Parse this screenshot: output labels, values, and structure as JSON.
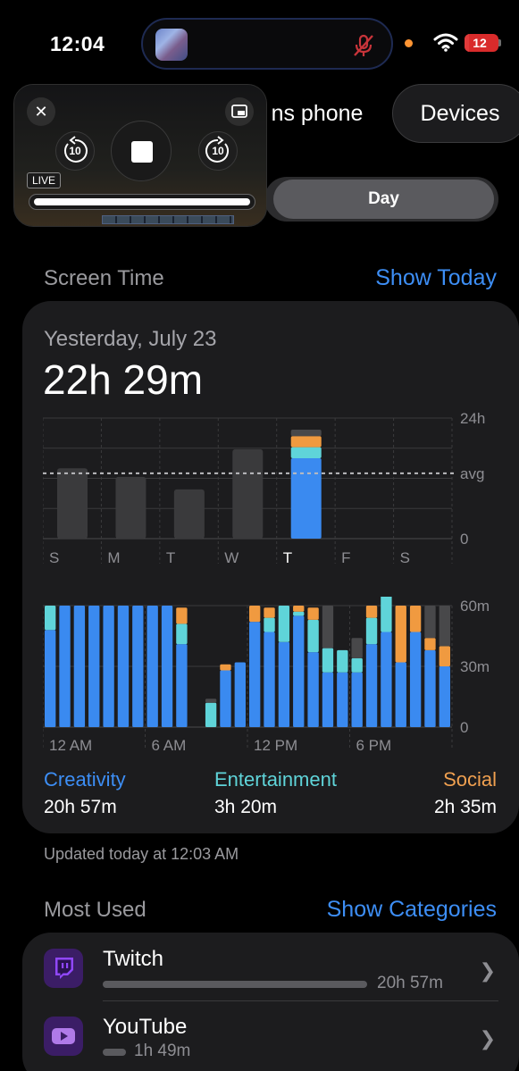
{
  "status_bar": {
    "time": "12:04",
    "battery": "12",
    "battery_level": 0.12,
    "icons": [
      "now-playing-art",
      "mic-muted-icon",
      "privacy-dot",
      "wifi-icon",
      "battery-charging-icon"
    ]
  },
  "device_tabs": {
    "phone_label": "ns phone",
    "devices_label": "Devices"
  },
  "segment": {
    "day_label": "Day"
  },
  "pip": {
    "live_label": "LIVE",
    "skip_back_label": "10",
    "skip_forward_label": "10",
    "progress": 1.0,
    "icons": [
      "close-icon",
      "pip-expand-icon",
      "skip-back-10-icon",
      "stop-icon",
      "skip-forward-10-icon"
    ]
  },
  "screen_time": {
    "section_title": "Screen Time",
    "show_today": "Show Today",
    "date_label": "Yesterday, July 23",
    "total": "22h 29m"
  },
  "chart_data": [
    {
      "type": "bar",
      "categories": [
        "S",
        "M",
        "T",
        "W",
        "T",
        "F",
        "S"
      ],
      "ytick_labels": [
        "24h",
        "avg",
        "0"
      ],
      "ylim": [
        0,
        24
      ],
      "avg_hours": 13,
      "values_hours": [
        14.0,
        12.3,
        9.8,
        17.8,
        22.5,
        0,
        0
      ],
      "stacked_selected_day": {
        "index": 4,
        "creativity": 16.0,
        "entertainment": 2.2,
        "social": 2.2,
        "other": 1.3
      },
      "colors": {
        "inactive": "#3a3a3c",
        "creativity": "#3a8af0",
        "entertainment": "#5fd4d9",
        "social": "#f09a40",
        "other": "#48484a"
      }
    },
    {
      "type": "bar",
      "x_tick_labels": [
        "12 AM",
        "6 AM",
        "12 PM",
        "6 PM"
      ],
      "ytick_labels": [
        "60m",
        "30m",
        "0"
      ],
      "ylim": [
        0,
        60
      ],
      "series": [
        {
          "name": "Creativity",
          "values": [
            48,
            60,
            60,
            60,
            60,
            60,
            60,
            60,
            60,
            41,
            0,
            0,
            28,
            32,
            52,
            47,
            42,
            55,
            37,
            27,
            27,
            27,
            41,
            47,
            32,
            47,
            38,
            30
          ]
        },
        {
          "name": "Entertainment",
          "values": [
            12,
            0,
            0,
            0,
            0,
            0,
            0,
            0,
            0,
            10,
            0,
            12,
            0,
            0,
            0,
            7,
            18,
            2,
            16,
            12,
            11,
            7,
            13,
            18,
            0,
            0,
            0,
            0
          ]
        },
        {
          "name": "Social",
          "values": [
            0,
            0,
            0,
            0,
            0,
            0,
            0,
            0,
            0,
            8,
            0,
            0,
            3,
            0,
            8,
            5,
            0,
            3,
            6,
            0,
            0,
            0,
            6,
            0,
            28,
            13,
            6,
            10
          ]
        }
      ],
      "other_values": [
        0,
        0,
        0,
        0,
        0,
        0,
        0,
        0,
        0,
        0,
        0,
        2,
        0,
        0,
        0,
        0,
        0,
        0,
        0,
        21,
        0,
        10,
        0,
        0,
        0,
        0,
        16,
        20
      ],
      "colors": {
        "creativity": "#3a8af0",
        "entertainment": "#5fd4d9",
        "social": "#f09a40",
        "other": "#48484a"
      }
    }
  ],
  "legend": [
    {
      "name": "Creativity",
      "value": "20h 57m",
      "color": "#3d8ef5"
    },
    {
      "name": "Entertainment",
      "value": "3h 20m",
      "color": "#5fd4d9"
    },
    {
      "name": "Social",
      "value": "2h 35m",
      "color": "#f0a050"
    }
  ],
  "updated_text": "Updated today at 12:03 AM",
  "most_used": {
    "section_title": "Most Used",
    "show_categories": "Show Categories",
    "apps": [
      {
        "name": "Twitch",
        "time": "20h 57m",
        "share": 1.0,
        "icon": "twitch-icon"
      },
      {
        "name": "YouTube",
        "time": "1h 49m",
        "share": 0.087,
        "icon": "youtube-icon"
      }
    ]
  }
}
